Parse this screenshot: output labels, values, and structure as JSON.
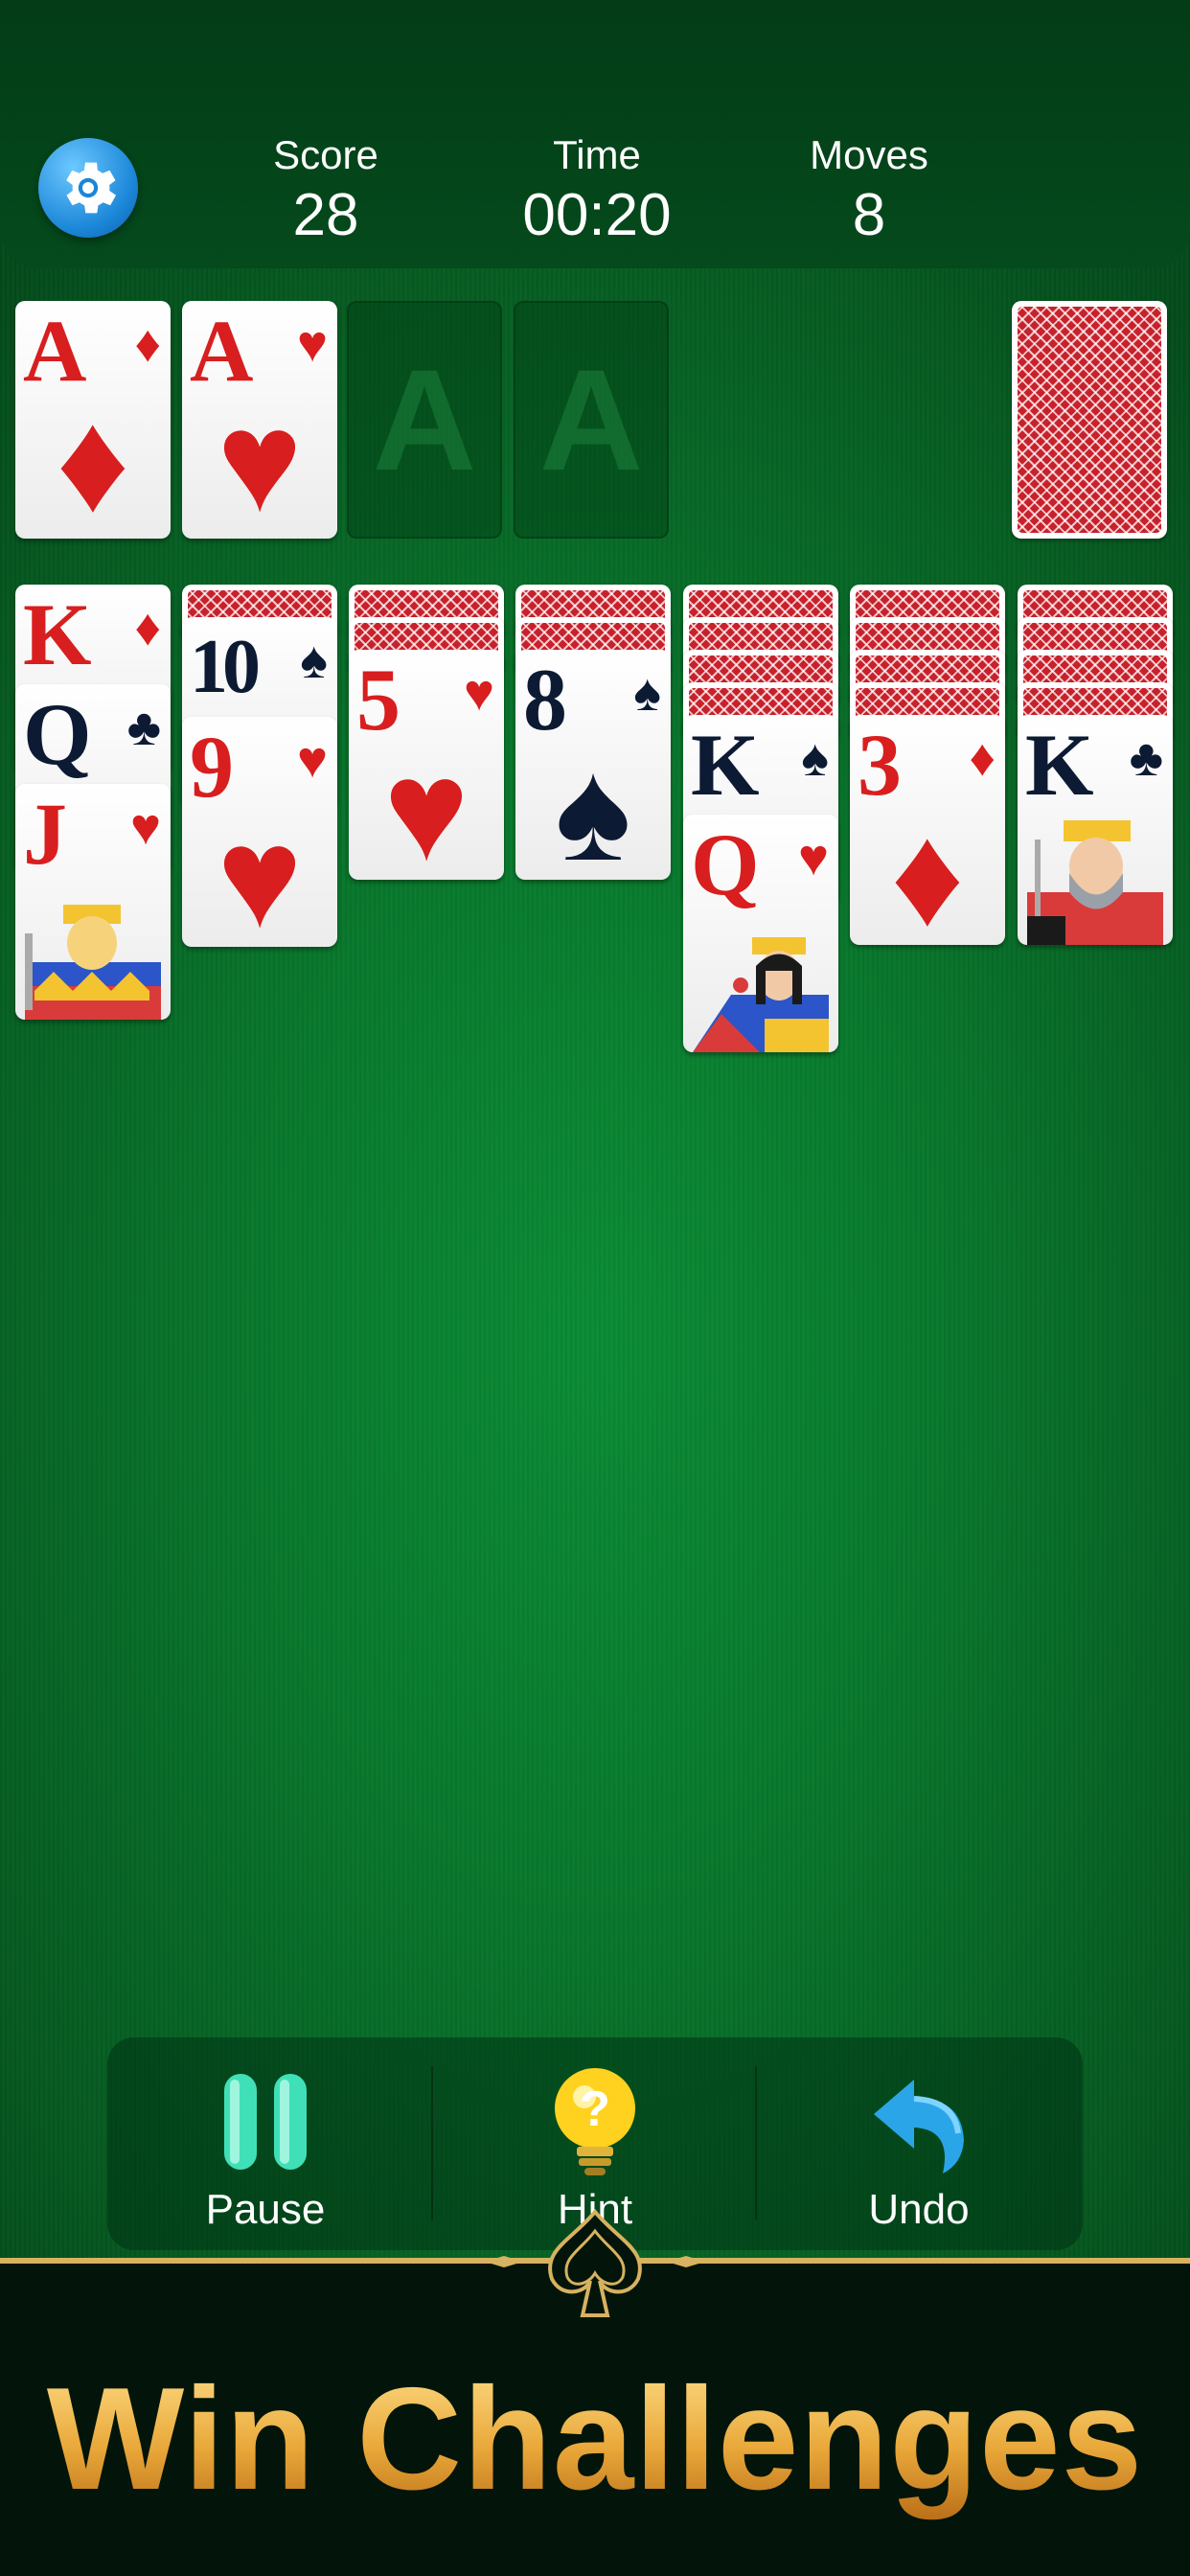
{
  "header": {
    "score_label": "Score",
    "score_value": "28",
    "time_label": "Time",
    "time_value": "00:20",
    "moves_label": "Moves",
    "moves_value": "8"
  },
  "foundations": [
    {
      "rank": "A",
      "suit": "diamonds",
      "symbol": "♦"
    },
    {
      "rank": "A",
      "suit": "hearts",
      "symbol": "♥"
    },
    {
      "empty_label": "A"
    },
    {
      "empty_label": "A"
    }
  ],
  "tableau": [
    {
      "face_down": 0,
      "face_up": [
        {
          "rank": "K",
          "symbol": "♦"
        },
        {
          "rank": "Q",
          "symbol": "♣"
        },
        {
          "rank": "J",
          "symbol": "♥"
        }
      ]
    },
    {
      "face_down": 1,
      "face_up": [
        {
          "rank": "10",
          "symbol": "♠"
        },
        {
          "rank": "9",
          "symbol": "♥"
        }
      ]
    },
    {
      "face_down": 2,
      "face_up": [
        {
          "rank": "5",
          "symbol": "♥"
        }
      ]
    },
    {
      "face_down": 2,
      "face_up": [
        {
          "rank": "8",
          "symbol": "♠"
        }
      ]
    },
    {
      "face_down": 4,
      "face_up": [
        {
          "rank": "K",
          "symbol": "♠"
        },
        {
          "rank": "Q",
          "symbol": "♥"
        }
      ]
    },
    {
      "face_down": 4,
      "face_up": [
        {
          "rank": "3",
          "symbol": "♦"
        }
      ]
    },
    {
      "face_down": 4,
      "face_up": [
        {
          "rank": "K",
          "symbol": "♣"
        }
      ]
    }
  ],
  "controls": {
    "pause_label": "Pause",
    "hint_label": "Hint",
    "undo_label": "Undo"
  },
  "banner": {
    "text": "Win Challenges"
  },
  "colors": {
    "red_suit": "#d81e1e",
    "black_suit": "#0c1a33",
    "felt": "#08772c",
    "gold": "#e9a83a"
  }
}
